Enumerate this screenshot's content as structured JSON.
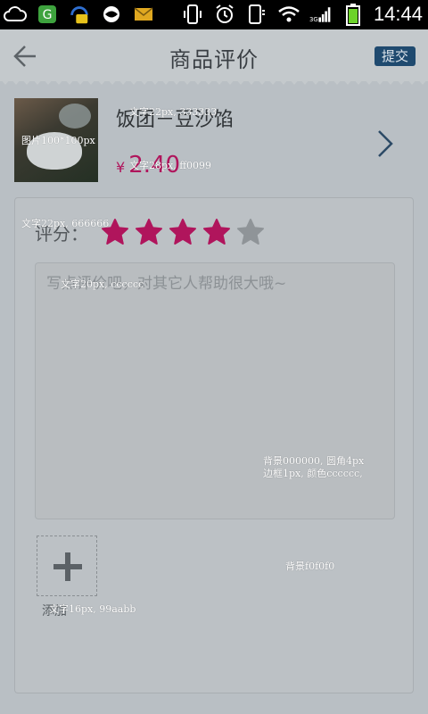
{
  "status_bar": {
    "time": "14:44",
    "left_icons": [
      "cloud-icon",
      "app-icon",
      "headset-chat-icon",
      "globe-icon",
      "mail-icon"
    ],
    "right_icons": [
      "vibrate-icon",
      "alarm-icon",
      "phone-icon",
      "wifi-icon",
      "signal-icon",
      "battery-icon"
    ],
    "network": "3G"
  },
  "header": {
    "title": "商品评价",
    "submit_label": "提交"
  },
  "product": {
    "name": "饭团－豆沙馅",
    "currency": "¥",
    "price": "2.40"
  },
  "review": {
    "rating_label": "评分：",
    "rating": 4,
    "max_rating": 5,
    "placeholder": "写点评价吧，对其它人帮助很大哦~",
    "add_photo_label": "添加"
  },
  "annotations": {
    "image_note": "图片100*100px",
    "name_note": "文字22px, 333333",
    "price_note": "文字28px, ff0099",
    "rating_note": "文字22px, 666666",
    "placeholder_note": "文字20px, cccccc",
    "box_note_line1": "背景000000, 圆角4px",
    "box_note_line2": "边框1px, 颜色cccccc,",
    "card_bg_note": "背景f0f0f0",
    "add_note": "文字16px, 99aabb"
  },
  "colors": {
    "star_filled": "#b0155c",
    "star_empty": "#8f9498",
    "price": "#b0155c",
    "submit_bg": "#1f4a6f"
  }
}
